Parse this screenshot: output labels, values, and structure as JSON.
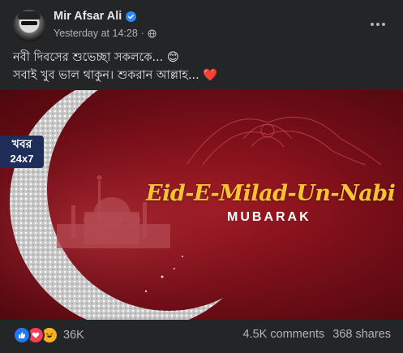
{
  "post": {
    "author": "Mir Afsar Ali",
    "timestamp": "Yesterday at 14:28",
    "separator": "·",
    "text_line1": "নবী দিবসের শুভেচ্ছা সকলকে... 😊",
    "text_line2": "সবাই খুব ভাল থাকুন। শুকরান আল্লাহ... ❤️"
  },
  "image": {
    "watermark_line1": "খবর",
    "watermark_line2": "24x7",
    "title": "Eid-E-Milad-Un-Nabi",
    "subtitle": "MUBARAK"
  },
  "footer": {
    "reaction_count": "36K",
    "comments": "4.5K comments",
    "shares": "368 shares"
  },
  "icons": [
    "verified-badge-icon",
    "globe-icon",
    "more-options-icon",
    "like-reaction-icon",
    "love-reaction-icon",
    "haha-reaction-icon"
  ],
  "colors": {
    "background": "#242526",
    "text_primary": "#e4e6eb",
    "text_secondary": "#b0b3b8",
    "verified_blue": "#2d88ff",
    "banner_gold": "#f4c430",
    "banner_red": "#7a0f19"
  }
}
